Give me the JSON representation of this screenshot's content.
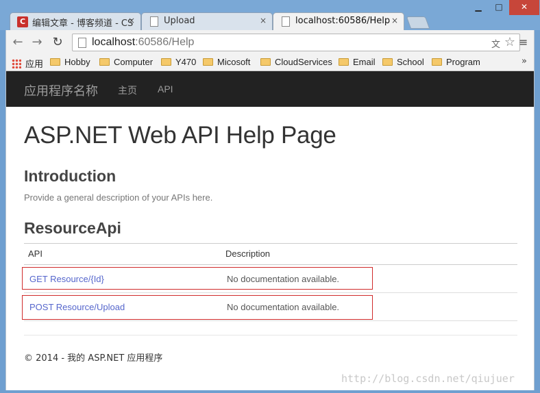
{
  "browser": {
    "tabs": [
      {
        "title": "编辑文章 - 博客频道 - CS",
        "icon": "csdn-logo-icon",
        "active": false
      },
      {
        "title": "Upload",
        "icon": "page-icon",
        "active": false
      },
      {
        "title": "localhost:60586/Help",
        "icon": "page-icon",
        "active": true
      }
    ],
    "close_glyph": "×",
    "window_controls": {
      "minimize": "▁",
      "maximize": "□",
      "close": "✕"
    },
    "nav": {
      "back": "←",
      "forward": "→",
      "reload": "↻"
    },
    "url": {
      "host": "localhost",
      "rest": ":60586/Help"
    },
    "translate_glyph": "文",
    "star_glyph": "☆",
    "menu_glyph": "≡",
    "bookmarks": [
      "应用",
      "Hobby",
      "Computer",
      "Y470",
      "Micosoft",
      "CloudServices",
      "Email",
      "School",
      "Program"
    ],
    "bookmarks_more": "»"
  },
  "app": {
    "brand": "应用程序名称",
    "nav": [
      "主页",
      "API"
    ]
  },
  "content": {
    "title": "ASP.NET Web API Help Page",
    "intro_heading": "Introduction",
    "intro_text": "Provide a general description of your APIs here.",
    "resource_heading": "ResourceApi",
    "table": {
      "headers": [
        "API",
        "Description"
      ],
      "rows": [
        {
          "api": "GET Resource/{Id}",
          "description": "No documentation available."
        },
        {
          "api": "POST Resource/Upload",
          "description": "No documentation available."
        }
      ]
    },
    "footer": "© 2014 - 我的 ASP.NET 应用程序"
  },
  "watermark": "http://blog.csdn.net/qiujuer",
  "colors": {
    "nav_bg": "#222222",
    "link": "#5566cc",
    "highlight_border": "#d02a2a"
  }
}
